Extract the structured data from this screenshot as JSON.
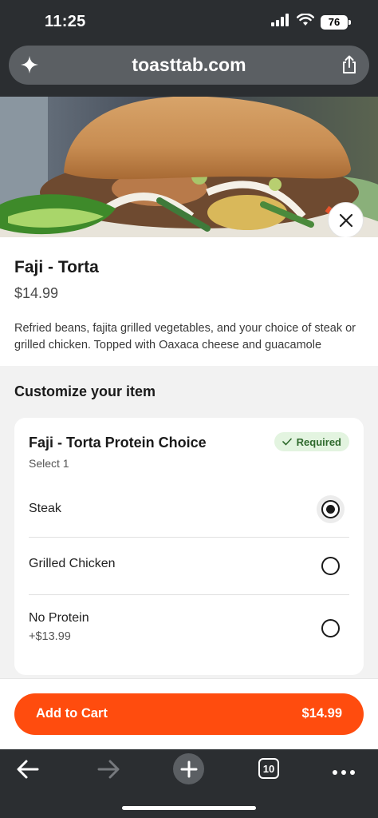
{
  "status_bar": {
    "time": "11:25",
    "battery": "76"
  },
  "browser": {
    "url": "toasttab.com",
    "tab_count": "10"
  },
  "item": {
    "title": "Faji - Torta",
    "price": "$14.99",
    "description": "Refried beans, fajita grilled vegetables, and your choice of steak or grilled chicken. Topped with Oaxaca cheese and guacamole"
  },
  "customize": {
    "title": "Customize your item",
    "group": {
      "title": "Faji - Torta Protein Choice",
      "subtitle": "Select 1",
      "badge": "Required",
      "options": [
        {
          "label": "Steak",
          "price": "",
          "selected": true
        },
        {
          "label": "Grilled Chicken",
          "price": "",
          "selected": false
        },
        {
          "label": "No Protein",
          "price": "+$13.99",
          "selected": false
        }
      ]
    }
  },
  "cart": {
    "label": "Add to Cart",
    "price": "$14.99"
  },
  "colors": {
    "accent": "#ff4c0e",
    "required_bg": "#e3f4e0",
    "required_text": "#2f6a2d"
  }
}
